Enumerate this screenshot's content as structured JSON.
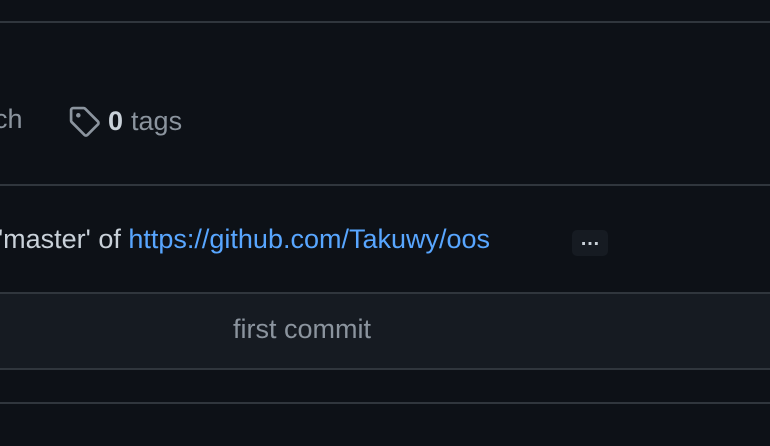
{
  "repo_meta": {
    "branch_text": "ch",
    "tags_count": "0",
    "tags_label": "tags",
    "tag_icon": "tag-icon"
  },
  "latest_commit": {
    "message_prefix": "'master' of ",
    "link_text": "https://github.com/Takuwy/oos",
    "ellipsis": "…"
  },
  "file_row": {
    "commit_message": "first commit"
  },
  "colors": {
    "background": "#0d1117",
    "row_background": "#161b22",
    "border": "#30363d",
    "link": "#58a6ff",
    "muted_text": "#8b949e",
    "text": "#c9d1d9"
  }
}
